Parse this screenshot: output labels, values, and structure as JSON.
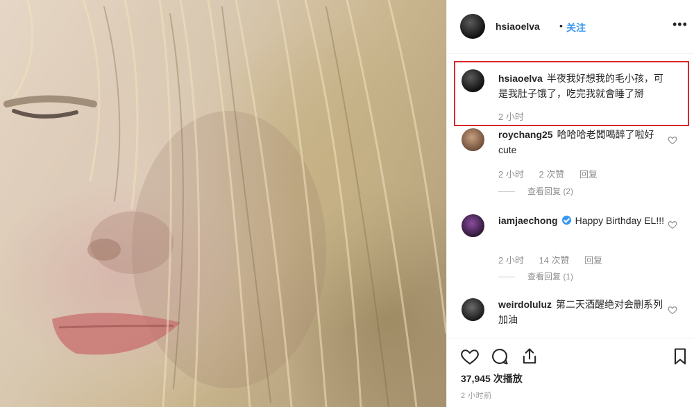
{
  "post": {
    "author": "hsiaoelva",
    "separator": "•",
    "follow_label": "关注",
    "more_label": "•••"
  },
  "caption": {
    "username": "hsiaoelva",
    "text": "半夜我好想我的毛小孩，可是我肚子饿了，吃完我就會睡了掰",
    "time": "2 小时"
  },
  "comments": [
    {
      "username": "roychang25",
      "text": "哈哈哈老闆喝醉了啦好cute",
      "time": "2 小时",
      "likes": "2 次赞",
      "reply_label": "回复",
      "view_replies": "查看回复 (2)"
    },
    {
      "username": "iamjaechong",
      "verified": true,
      "text": "Happy Birthday EL!!!",
      "time": "2 小时",
      "likes": "14 次赞",
      "reply_label": "回复",
      "view_replies": "查看回复 (1)"
    },
    {
      "username": "weirdoluluz",
      "text": "第二天酒醒绝对会删系列 加油"
    }
  ],
  "stats": {
    "views": "37,945 次播放",
    "posted": "2 小时前"
  },
  "icons": {
    "like": "heart-icon",
    "comment": "comment-bubble-icon",
    "share": "share-icon",
    "save": "bookmark-icon"
  },
  "colors": {
    "follow": "#3897f0",
    "highlight_border": "#d9282f",
    "muted_text": "#8e8e8e"
  }
}
